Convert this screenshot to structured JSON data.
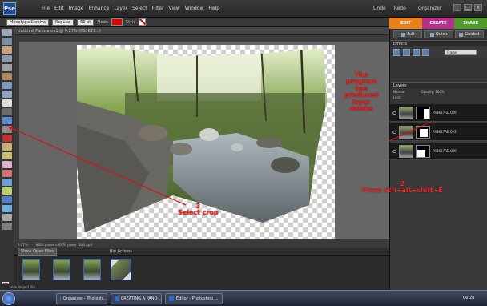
{
  "app": {
    "logo_text": "Pse"
  },
  "menu": [
    "File",
    "Edit",
    "Image",
    "Enhance",
    "Layer",
    "Select",
    "Filter",
    "View",
    "Window",
    "Help"
  ],
  "top_right": {
    "undo": "Undo",
    "redo": "Redo",
    "organizer": "Organizer"
  },
  "window_controls": {
    "min": "_",
    "max": "□",
    "close": "x"
  },
  "options_bar": {
    "font": "Monotype Corsiva",
    "style": "Regular",
    "size": "60 pt",
    "mode_label": "Mode",
    "style_label": "Style",
    "accent_color": "#e00000"
  },
  "mode_tabs": {
    "edit": "EDIT",
    "create": "CREATE",
    "share": "SHARE"
  },
  "document": {
    "tab_title": "Untitled_Panorama1 @ 9.27% (PS3627...)",
    "zoom": "9.27%",
    "info": "8816 pixels x 6370 pixels (240 ppi)"
  },
  "project_bin": {
    "dropdown": "Show Open Files",
    "bin_actions": "Bin Actions",
    "hide": "Hide Project Bin"
  },
  "right_panel": {
    "tabs": [
      "Full",
      "Quick",
      "Guided"
    ],
    "effects_title": "Effects",
    "frame_dropdown": "Frame",
    "layers_title": "Layers",
    "blend_mode": "Normal",
    "opacity": "Opacity: 100%",
    "lock": "Lock:",
    "layers": [
      {
        "name": "PS3627RD.ORF"
      },
      {
        "name": "PS3627RE.ORF"
      },
      {
        "name": "PS3627RD.ORF"
      }
    ]
  },
  "annotations": {
    "a": [
      "The",
      "program",
      "has",
      "produced",
      "layer",
      "masks"
    ],
    "b": [
      "2",
      "Press ctrl+alt+shift+E"
    ],
    "c": [
      "3",
      "Select crop"
    ]
  },
  "taskbar": {
    "items": [
      "Organizer - Photosh...",
      "CREATING A PANO...",
      "Editor - Photoshop ..."
    ],
    "clock": "06:28"
  }
}
